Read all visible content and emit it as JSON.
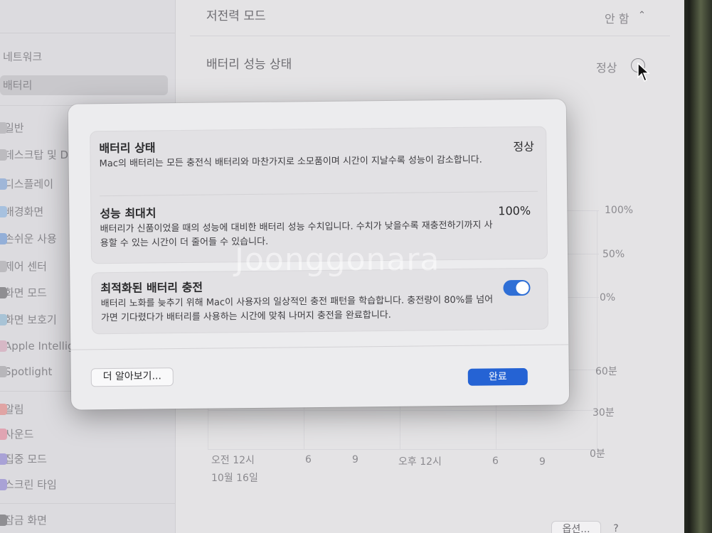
{
  "sidebar": {
    "items": [
      {
        "label": "네트워크",
        "icon": "network-icon"
      },
      {
        "label": "배터리",
        "icon": "battery-icon"
      },
      {
        "label": "일반",
        "icon": "gear-icon"
      },
      {
        "label": "데스크탑 및 Dock",
        "icon": "dock-icon"
      },
      {
        "label": "디스플레이",
        "icon": "display-icon"
      },
      {
        "label": "배경화면",
        "icon": "wallpaper-icon"
      },
      {
        "label": "손쉬운 사용",
        "icon": "accessibility-icon"
      },
      {
        "label": "제어 센터",
        "icon": "control-center-icon"
      },
      {
        "label": "화면 모드",
        "icon": "appearance-icon"
      },
      {
        "label": "화면 보호기",
        "icon": "screensaver-icon"
      },
      {
        "label": "Apple Intelligence",
        "icon": "apple-intelligence-icon"
      },
      {
        "label": "Spotlight",
        "icon": "spotlight-icon"
      },
      {
        "label": "알림",
        "icon": "notifications-icon"
      },
      {
        "label": "사운드",
        "icon": "sound-icon"
      },
      {
        "label": "집중 모드",
        "icon": "focus-icon"
      },
      {
        "label": "스크린 타임",
        "icon": "screen-time-icon"
      },
      {
        "label": "잠금 화면",
        "icon": "lock-screen-icon"
      }
    ]
  },
  "main": {
    "low_power_label": "저전력 모드",
    "low_power_value": "안 함",
    "battery_health_label": "배터리 성능 상태",
    "battery_health_value": "정상",
    "chart": {
      "level_ticks": [
        "100%",
        "50%",
        "0%"
      ],
      "time_ticks": [
        "60분",
        "30분",
        "0분"
      ],
      "x_ticks": [
        "오전 12시",
        "6",
        "9",
        "오후 12시",
        "6",
        "9"
      ],
      "date_label": "10월 16일"
    },
    "options_label": "옵션...",
    "help_label": "?"
  },
  "modal": {
    "status_title": "배터리 상태",
    "status_desc": "Mac의 배터리는 모든 충전식 배터리와 마찬가지로 소모품이며 시간이 지날수록 성능이 감소합니다.",
    "status_value": "정상",
    "capacity_title": "성능 최대치",
    "capacity_desc": "배터리가 신품이었을 때의 성능에 대비한 배터리 성능 수치입니다. 수치가 낮을수록 재충전하기까지 사용할 수 있는 시간이 더 줄어들 수 있습니다.",
    "capacity_value": "100%",
    "optimized_title": "최적화된 배터리 충전",
    "optimized_desc": "배터리 노화를 늦추기 위해 Mac이 사용자의 일상적인 충전 패턴을 학습합니다. 충전량이 80%를 넘어가면 기다렸다가 배터리를 사용하는 시간에 맞춰 나머지 충전을 완료합니다.",
    "optimized_on": true,
    "learn_more_label": "더 알아보기...",
    "done_label": "완료"
  },
  "watermark": "Joonggonara",
  "colors": {
    "accent": "#2563d4",
    "toggle_on": "#2f6fd6"
  }
}
